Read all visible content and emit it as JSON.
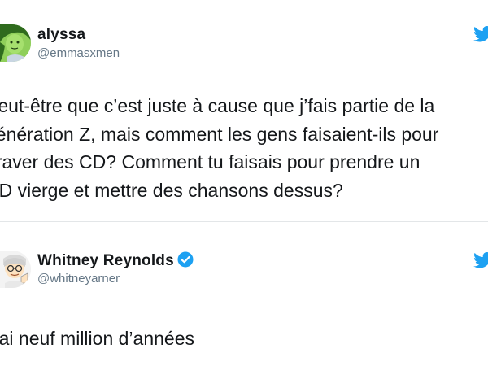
{
  "tweets": [
    {
      "display_name": "alyssa",
      "handle": "@emmasxmen",
      "verified": false,
      "lines": [
        "Peut-être que c’est juste à cause que j’fais partie de la",
        "génération Z, mais comment les gens faisaient-ils pour",
        "graver des CD? Comment tu faisais pour prendre un",
        "CD vierge et mettre des chansons dessus?"
      ]
    },
    {
      "display_name": "Whitney Reynolds",
      "handle": "@whitneyarner",
      "verified": true,
      "lines": [
        "J’ai neuf million d’années"
      ]
    }
  ],
  "icons": {
    "platform": "twitter-bird-icon",
    "verified": "verified-badge-icon"
  },
  "colors": {
    "brand_blue": "#1da1f2",
    "text": "#14171a",
    "muted": "#657786",
    "divider": "#e3e6e8"
  }
}
